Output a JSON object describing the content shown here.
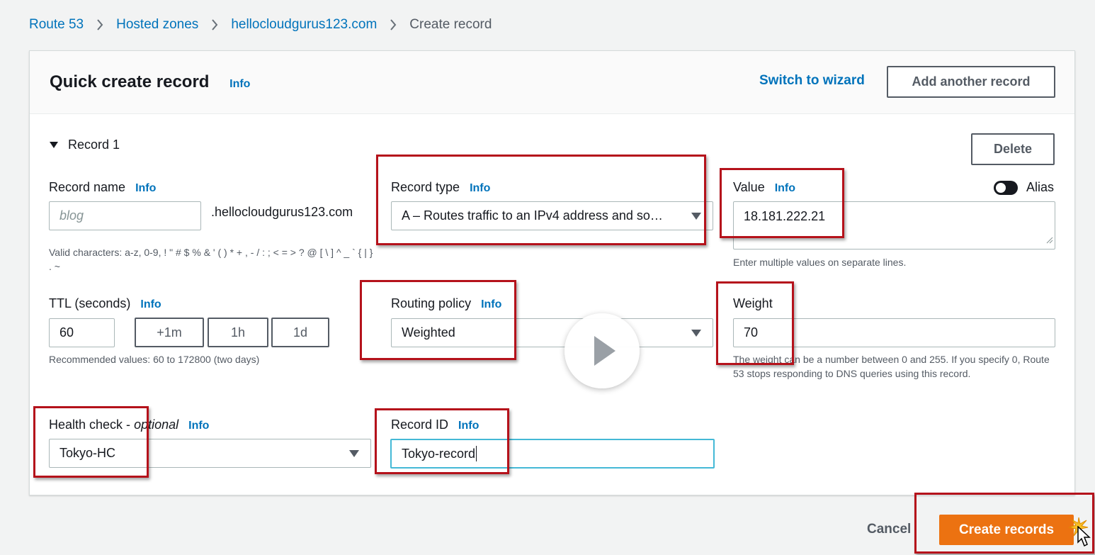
{
  "breadcrumb": {
    "items": [
      "Route 53",
      "Hosted zones",
      "hellocloudgurus123.com"
    ],
    "current": "Create record"
  },
  "header": {
    "title": "Quick create record",
    "info": "Info",
    "switch_wizard": "Switch to wizard",
    "add_record": "Add another record"
  },
  "record": {
    "section_label": "Record 1",
    "delete_label": "Delete",
    "record_name": {
      "label": "Record name",
      "info": "Info",
      "placeholder": "blog",
      "suffix": ".hellocloudgurus123.com",
      "hint": "Valid characters: a-z, 0-9, ! \" # $ % & ' ( ) * + , - / : ; < = > ? @ [ \\ ] ^ _ ` { | } . ~"
    },
    "record_type": {
      "label": "Record type",
      "info": "Info",
      "value": "A – Routes traffic to an IPv4 address and so…"
    },
    "value": {
      "label": "Value",
      "info": "Info",
      "value": "18.181.222.21",
      "hint": "Enter multiple values on separate lines.",
      "alias_label": "Alias"
    },
    "ttl": {
      "label": "TTL (seconds)",
      "info": "Info",
      "value": "60",
      "buttons": [
        "+1m",
        "1h",
        "1d"
      ],
      "hint": "Recommended values: 60 to 172800 (two days)"
    },
    "routing_policy": {
      "label": "Routing policy",
      "info": "Info",
      "value": "Weighted"
    },
    "weight": {
      "label": "Weight",
      "value": "70",
      "hint": "The weight can be a number between 0 and 255. If you specify 0, Route 53 stops responding to DNS queries using this record."
    },
    "health_check": {
      "label": "Health check - ",
      "optional": "optional",
      "info": "Info",
      "value": "Tokyo-HC"
    },
    "record_id": {
      "label": "Record ID",
      "info": "Info",
      "value": "Tokyo-record"
    }
  },
  "footer": {
    "cancel": "Cancel",
    "create": "Create records"
  },
  "colors": {
    "link": "#0073bb",
    "primary": "#ec7211",
    "highlight": "#b5121b"
  }
}
